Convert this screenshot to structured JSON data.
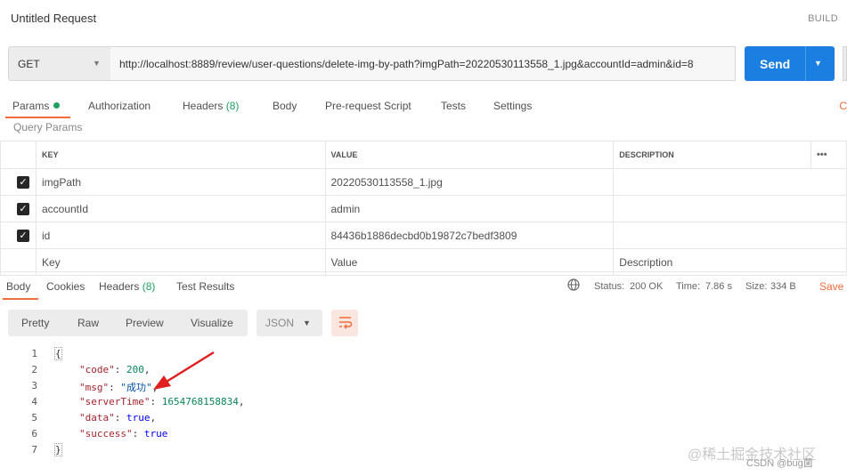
{
  "header": {
    "title": "Untitled Request",
    "build": "BUILD"
  },
  "request": {
    "method": "GET",
    "url": "http://localhost:8889/review/user-questions/delete-img-by-path?imgPath=20220530113558_1.jpg&accountId=admin&id=8",
    "send_label": "Send"
  },
  "request_tabs": {
    "params": "Params",
    "authorization": "Authorization",
    "headers": "Headers",
    "headers_count": "(8)",
    "body": "Body",
    "prerequest": "Pre-request Script",
    "tests": "Tests",
    "settings": "Settings",
    "cookies_edge": "C"
  },
  "query_params": {
    "label": "Query Params",
    "columns": {
      "key": "KEY",
      "value": "VALUE",
      "description": "DESCRIPTION",
      "more": "•••"
    },
    "rows": [
      {
        "key": "imgPath",
        "value": "20220530113558_1.jpg"
      },
      {
        "key": "accountId",
        "value": "admin"
      },
      {
        "key": "id",
        "value": "84436b1886decbd0b19872c7bedf3809"
      }
    ],
    "placeholders": {
      "key": "Key",
      "value": "Value",
      "description": "Description"
    }
  },
  "response_tabs": {
    "body": "Body",
    "cookies": "Cookies",
    "headers": "Headers",
    "headers_count": "(8)",
    "test_results": "Test Results"
  },
  "status": {
    "status_label": "Status:",
    "status_value": "200 OK",
    "time_label": "Time:",
    "time_value": "7.86 s",
    "size_label": "Size:",
    "size_value": "334 B",
    "save": "Save"
  },
  "body_toolbar": {
    "pretty": "Pretty",
    "raw": "Raw",
    "preview": "Preview",
    "visualize": "Visualize",
    "format": "JSON"
  },
  "response_body": {
    "line_numbers": [
      "1",
      "2",
      "3",
      "4",
      "5",
      "6",
      "7"
    ],
    "open": "{",
    "close": "}",
    "fields": [
      {
        "key": "\"code\"",
        "value": "200"
      },
      {
        "key": "\"msg\"",
        "value": "\"成功\""
      },
      {
        "key": "\"serverTime\"",
        "value": "1654768158834"
      },
      {
        "key": "\"data\"",
        "value": "true"
      },
      {
        "key": "\"success\"",
        "value": "true"
      }
    ]
  },
  "watermark": {
    "text": "@稀土掘金技术社区",
    "sub": "CSDN @bug菌"
  },
  "colors": {
    "accent": "#f26b3a",
    "send": "#1a7fe0",
    "ok": "#20a060"
  }
}
